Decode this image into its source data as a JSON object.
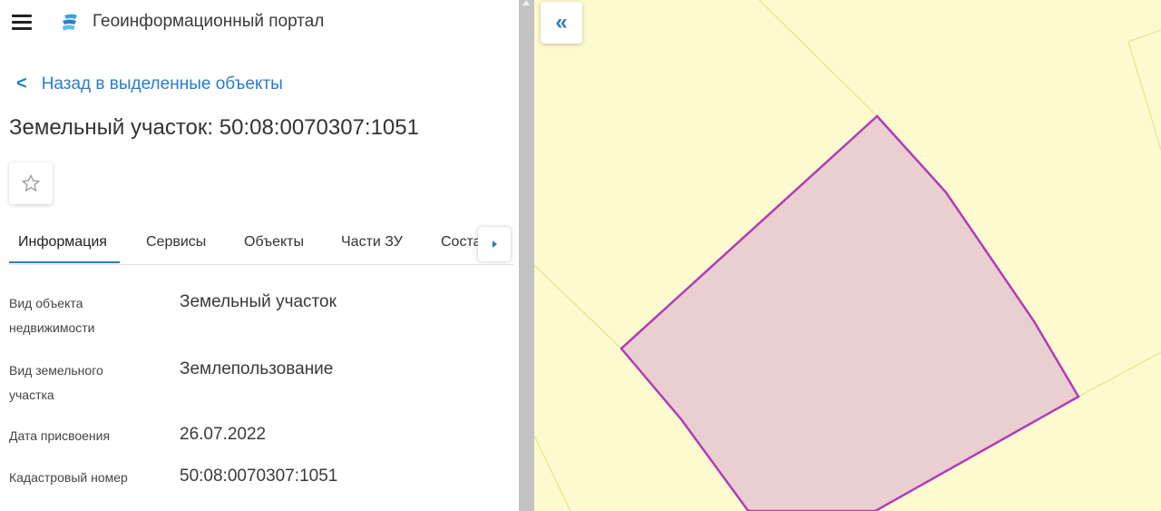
{
  "header": {
    "app_title": "Геоинформационный портал"
  },
  "nav": {
    "back_label": "Назад в выделенные объекты"
  },
  "object": {
    "title": "Земельный участок: 50:08:0070307:1051"
  },
  "tabs": [
    {
      "label": "Информация",
      "active": true
    },
    {
      "label": "Сервисы"
    },
    {
      "label": "Объекты"
    },
    {
      "label": "Части ЗУ"
    },
    {
      "label": "Соста"
    }
  ],
  "fields": [
    {
      "label_line1": "Вид объекта",
      "label_line2": "недвижимости",
      "value": "Земельный участок"
    },
    {
      "label_line1": "Вид земельного",
      "label_line2": "участка",
      "value": "Землепользование"
    },
    {
      "label_line1": "Дата присвоения",
      "value": "26.07.2022"
    },
    {
      "label_line1": "Кадастровый номер",
      "value": "50:08:0070307:1051"
    }
  ],
  "map": {
    "collapse_symbol": "«",
    "parcel_fill": "#e9cfcf",
    "parcel_stroke": "#b23bb8",
    "background": "#fefad0",
    "boundary_color": "#ede59a"
  },
  "colors": {
    "accent": "#2b7cc9"
  }
}
